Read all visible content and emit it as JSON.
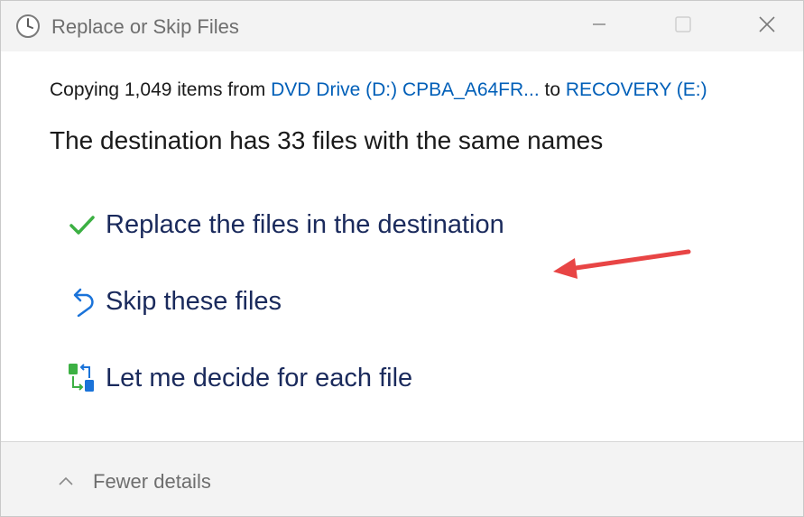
{
  "window": {
    "title": "Replace or Skip Files",
    "title_icon": "clock-icon",
    "controls": [
      "minimize-icon",
      "maximize-icon",
      "close-icon"
    ]
  },
  "copy_info": {
    "prefix": "Copying 1,049 items from ",
    "source": "DVD Drive (D:) CPBA_A64FR...",
    "middle": " to ",
    "destination": "RECOVERY (E:)"
  },
  "heading": "The destination has 33 files with the same names",
  "options": [
    {
      "label": "Replace the files in the destination",
      "icon": "checkmark-icon"
    },
    {
      "label": "Skip these files",
      "icon": "skip-undo-icon"
    },
    {
      "label": "Let me decide for each file",
      "icon": "compare-files-icon"
    }
  ],
  "annotation": {
    "icon": "red-arrow-icon",
    "color": "#e84545"
  },
  "footer": {
    "toggle_label": "Fewer details",
    "toggle_icon": "chevron-up-icon"
  },
  "colors": {
    "link": "#005fb8",
    "option_text": "#1a2a5c",
    "check": "#3cb043",
    "skip": "#1a73d9"
  }
}
